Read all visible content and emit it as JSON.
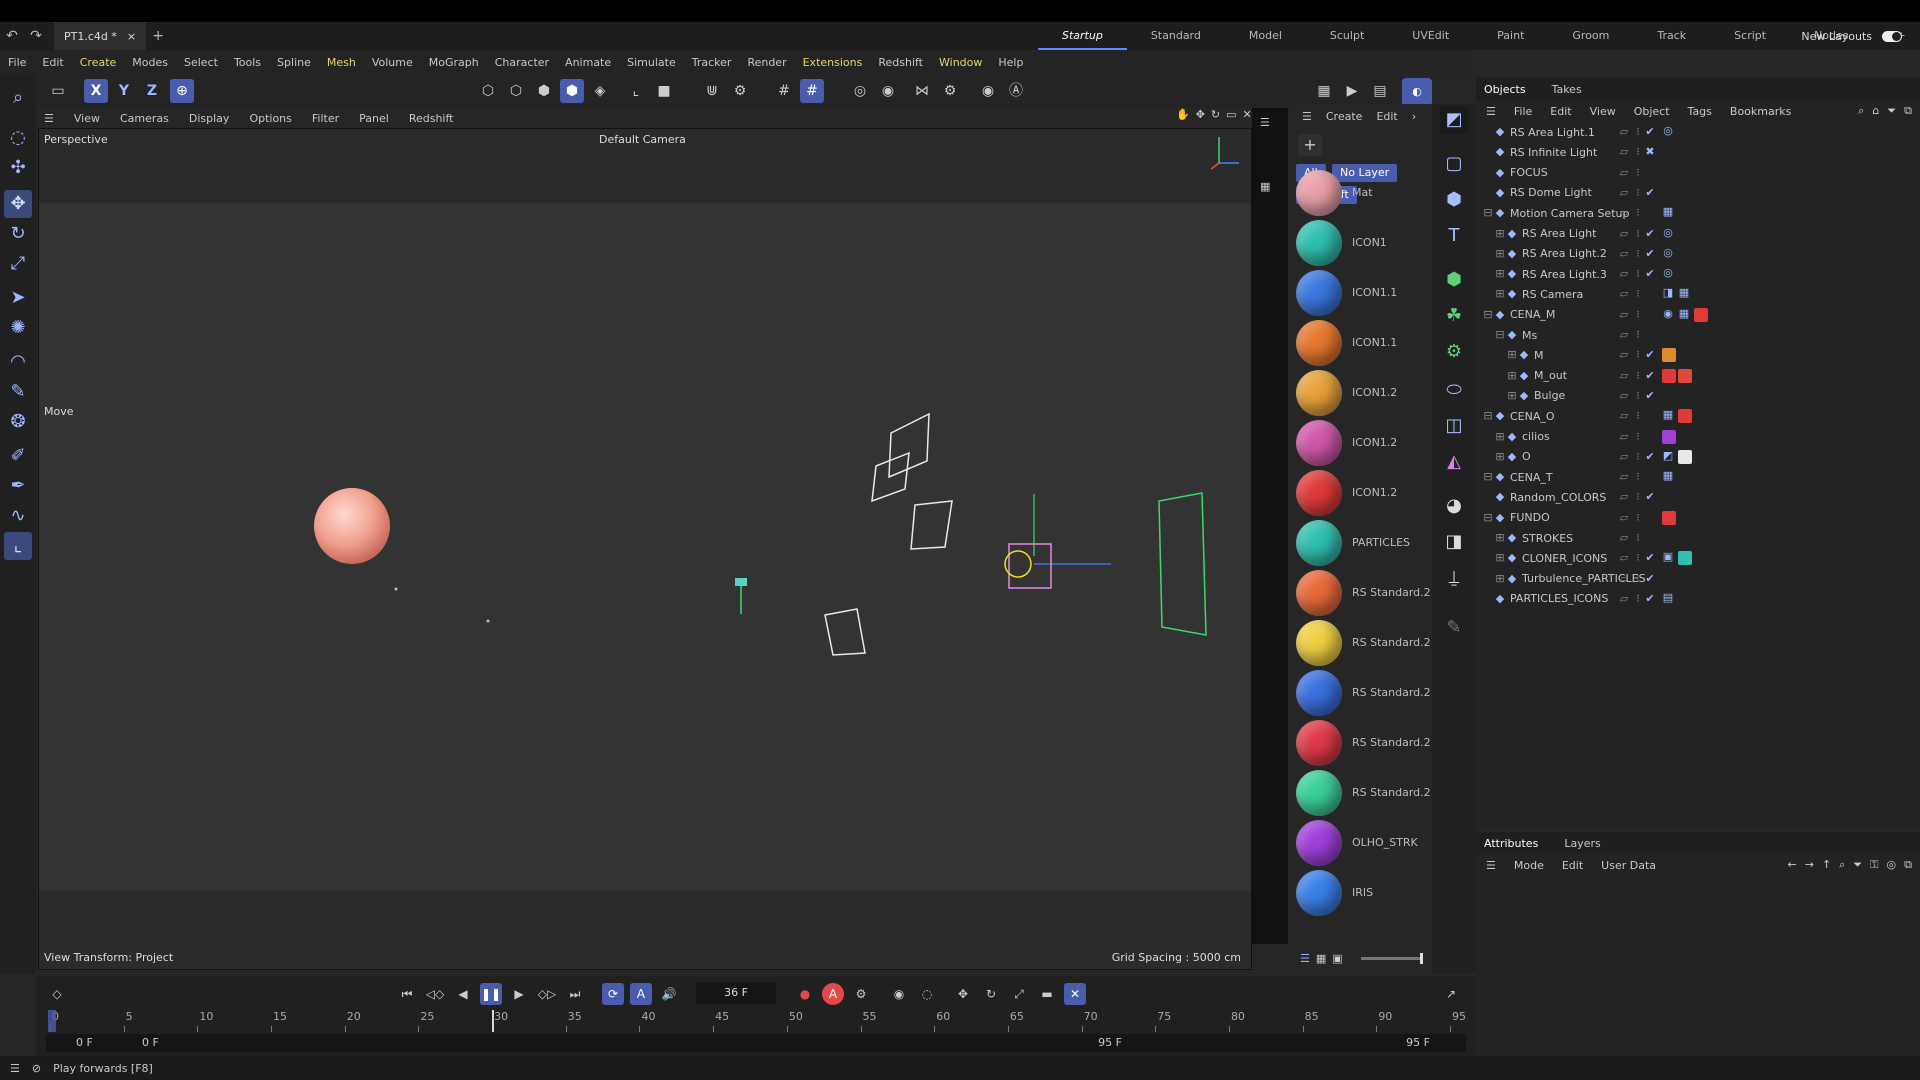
{
  "titlebar": {
    "doc_tab": "PT1.c4d *",
    "close": "×",
    "add": "+"
  },
  "layouts": [
    "Startup",
    "Standard",
    "Model",
    "Sculpt",
    "UVEdit",
    "Paint",
    "Groom",
    "Track",
    "Script",
    "Nodes"
  ],
  "active_layout": "Startup",
  "new_layouts": "New Layouts",
  "menu": [
    "File",
    "Edit",
    "Create",
    "Modes",
    "Select",
    "Tools",
    "Spline",
    "Mesh",
    "Volume",
    "MoGraph",
    "Character",
    "Animate",
    "Simulate",
    "Tracker",
    "Render",
    "Extensions",
    "Redshift",
    "Window",
    "Help"
  ],
  "menu_highlight": [
    "Create",
    "Mesh",
    "Extensions",
    "Window"
  ],
  "axis_buttons": {
    "x": "X",
    "y": "Y",
    "z": "Z"
  },
  "viewport": {
    "menu": [
      "View",
      "Cameras",
      "Display",
      "Options",
      "Filter",
      "Panel",
      "Redshift"
    ],
    "name": "Perspective",
    "camera": "Default Camera",
    "tool": "Move",
    "view_transform": "View Transform: Project",
    "grid_spacing": "Grid Spacing : 5000 cm"
  },
  "material_manager": {
    "menu": [
      "Create",
      "Edit"
    ],
    "filter_all": "All",
    "filter_nolayer": "No Layer",
    "filter_redshift": "Redshift",
    "materials": [
      {
        "name": "Mat",
        "color": "#e9a0a8"
      },
      {
        "name": "ICON1",
        "color": "#2fc0b0"
      },
      {
        "name": "ICON1.1",
        "color": "#3a78e0"
      },
      {
        "name": "ICON1.1",
        "color": "#e8772f"
      },
      {
        "name": "ICON1.2",
        "color": "#e9a23a"
      },
      {
        "name": "ICON1.2",
        "color": "#d058a8"
      },
      {
        "name": "ICON1.2",
        "color": "#e03a3a"
      },
      {
        "name": "PARTICLES",
        "color": "#2fc0b0"
      },
      {
        "name": "RS Standard.2",
        "color": "#e86a3a"
      },
      {
        "name": "RS Standard.2",
        "color": "#f0d040"
      },
      {
        "name": "RS Standard.2",
        "color": "#3a70e0"
      },
      {
        "name": "RS Standard.2",
        "color": "#e03a4a"
      },
      {
        "name": "RS Standard.2",
        "color": "#3ad09a"
      },
      {
        "name": "OLHO_STRK",
        "color": "#a040d8"
      },
      {
        "name": "IRIS",
        "color": "#3a80e8"
      }
    ]
  },
  "objects_panel": {
    "tabs": [
      "Objects",
      "Takes"
    ],
    "menu": [
      "File",
      "Edit",
      "View",
      "Object",
      "Tags",
      "Bookmarks"
    ],
    "rows": [
      {
        "name": "RS Area Light.1",
        "indent": 0,
        "status": "check",
        "tags": [
          "target"
        ]
      },
      {
        "name": "RS Infinite Light",
        "indent": 0,
        "status": "cross",
        "tags": []
      },
      {
        "name": "FOCUS",
        "indent": 0,
        "status": "",
        "tags": []
      },
      {
        "name": "RS Dome Light",
        "indent": 0,
        "status": "check",
        "tags": []
      },
      {
        "name": "Motion Camera Setup",
        "indent": 0,
        "status": "",
        "tags": [
          "film"
        ]
      },
      {
        "name": "RS Area Light",
        "indent": 1,
        "status": "check",
        "tags": [
          "target"
        ]
      },
      {
        "name": "RS Area Light.2",
        "indent": 1,
        "status": "check",
        "tags": [
          "target"
        ]
      },
      {
        "name": "RS Area Light.3",
        "indent": 1,
        "status": "check",
        "tags": [
          "target"
        ]
      },
      {
        "name": "RS Camera",
        "indent": 1,
        "status": "",
        "tags": [
          "cam",
          "film"
        ]
      },
      {
        "name": "CENA_M",
        "indent": 0,
        "status": "",
        "tags": [
          "eye",
          "film",
          "red"
        ]
      },
      {
        "name": "Ms",
        "indent": 1,
        "status": "",
        "tags": []
      },
      {
        "name": "M",
        "indent": 2,
        "status": "check",
        "tags": [
          "orange"
        ]
      },
      {
        "name": "M_out",
        "indent": 2,
        "status": "check",
        "tags": [
          "red",
          "red2"
        ]
      },
      {
        "name": "Bulge",
        "indent": 2,
        "status": "check",
        "tags": []
      },
      {
        "name": "CENA_O",
        "indent": 0,
        "status": "",
        "tags": [
          "film",
          "red"
        ]
      },
      {
        "name": "cilios",
        "indent": 1,
        "status": "",
        "tags": [
          "purple"
        ]
      },
      {
        "name": "O",
        "indent": 1,
        "status": "check",
        "tags": [
          "doc",
          "white"
        ]
      },
      {
        "name": "CENA_T",
        "indent": 0,
        "status": "",
        "tags": [
          "film"
        ]
      },
      {
        "name": "Random_COLORS",
        "indent": 0,
        "status": "check",
        "tags": []
      },
      {
        "name": "FUNDO",
        "indent": 0,
        "status": "",
        "tags": [
          "red"
        ]
      },
      {
        "name": "STROKES",
        "indent": 1,
        "status": "",
        "tags": []
      },
      {
        "name": "CLONER_ICONS",
        "indent": 1,
        "status": "check",
        "tags": [
          "grid",
          "teal"
        ]
      },
      {
        "name": "Turbulence_PARTICLES",
        "indent": 1,
        "status": "check",
        "tags": []
      },
      {
        "name": "PARTICLES_ICONS",
        "indent": 0,
        "status": "check",
        "tags": [
          "cal"
        ]
      }
    ]
  },
  "attributes_panel": {
    "tabs": [
      "Attributes",
      "Layers"
    ],
    "menu": [
      "Mode",
      "Edit",
      "User Data"
    ]
  },
  "timeline": {
    "current_frame": "36 F",
    "ticks": [
      "0",
      "5",
      "10",
      "15",
      "20",
      "25",
      "30",
      "35",
      "40",
      "45",
      "50",
      "55",
      "60",
      "65",
      "70",
      "75",
      "80",
      "85",
      "90",
      "95"
    ],
    "start_field": "0 F",
    "start_field2": "0 F",
    "end_field": "95 F",
    "end_field2": "95 F",
    "playhead_frame": 30
  },
  "status": {
    "text": "Play forwards [F8]"
  },
  "colors": {
    "accent": "#4a5cad",
    "check": "#52d36b",
    "cross": "#ff4a4a"
  }
}
